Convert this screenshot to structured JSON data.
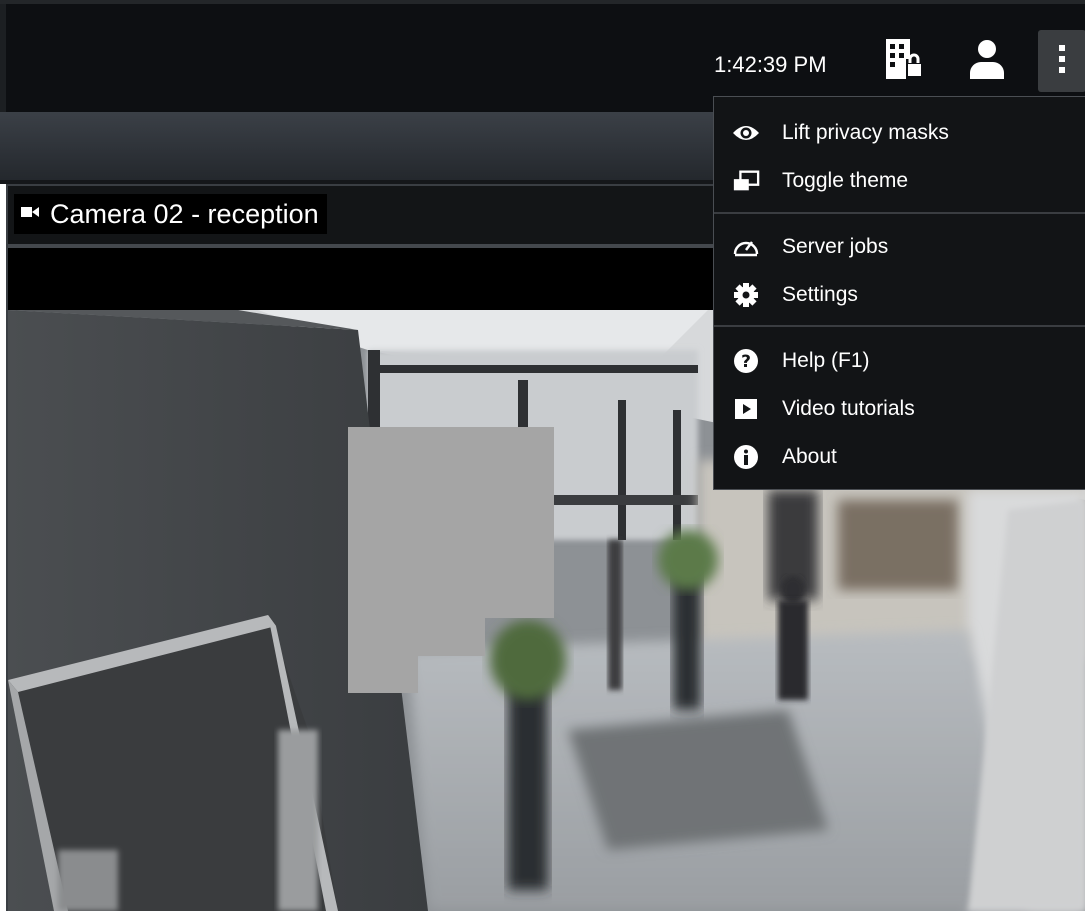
{
  "topbar": {
    "clock": "1:42:39 PM",
    "icons": [
      "building-lock-icon",
      "user-icon",
      "more-vertical-icon"
    ]
  },
  "camera": {
    "title": "Camera 02 - reception",
    "icon": "video-camera-icon"
  },
  "menu": {
    "groups": [
      [
        {
          "label": "Lift privacy masks",
          "icon": "eye-icon"
        },
        {
          "label": "Toggle theme",
          "icon": "toggle-theme-icon"
        }
      ],
      [
        {
          "label": "Server jobs",
          "icon": "gauge-icon"
        },
        {
          "label": "Settings",
          "icon": "gear-icon"
        }
      ],
      [
        {
          "label": "Help (F1)",
          "icon": "question-icon"
        },
        {
          "label": "Video tutorials",
          "icon": "play-icon"
        },
        {
          "label": "About",
          "icon": "info-icon"
        }
      ]
    ]
  }
}
